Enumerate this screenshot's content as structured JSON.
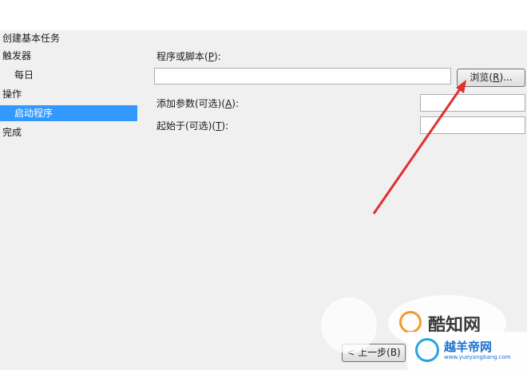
{
  "wizard": {
    "title": "创建基本任务",
    "steps": [
      {
        "label": "触发器"
      },
      {
        "label": "每日"
      },
      {
        "label": "操作"
      },
      {
        "label": "启动程序"
      },
      {
        "label": "完成"
      }
    ],
    "selected_step": "启动程序"
  },
  "form": {
    "program_label": "程序或脚本",
    "program_key": "P",
    "program_value": "",
    "browse_label": "浏览",
    "browse_key": "R",
    "args_label": "添加参数(可选)",
    "args_key": "A",
    "args_value": "",
    "start_label": "起始于(可选)",
    "start_key": "T",
    "start_value": ""
  },
  "footer": {
    "back_button": "< 上一步(B)"
  },
  "watermarks": {
    "kuzhi": "酷知网",
    "yueyang_cn": "越羊帝网",
    "yueyang_url": "www.yueyangbang.com"
  },
  "colors": {
    "dialog_bg": "#f0f0f0",
    "selected_bg": "#3399ff",
    "annotation_arrow": "#e03030"
  }
}
